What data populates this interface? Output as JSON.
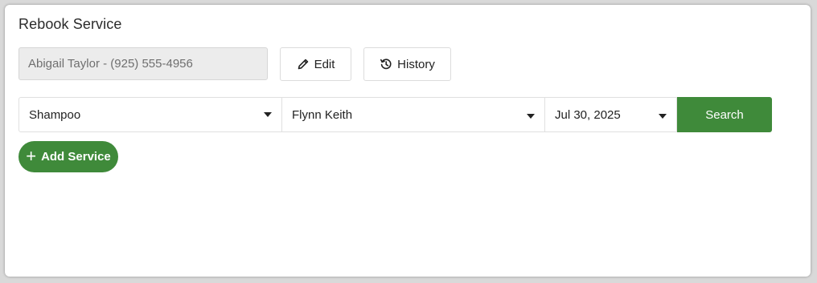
{
  "card": {
    "title": "Rebook Service"
  },
  "customer": {
    "value": "Abigail Taylor - (925) 555-4956"
  },
  "actions": {
    "edit_label": "Edit",
    "history_label": "History"
  },
  "filters": {
    "service": {
      "selected": "Shampoo"
    },
    "staff": {
      "selected": "Flynn Keith"
    },
    "date": {
      "selected": "Jul 30, 2025"
    },
    "search_label": "Search"
  },
  "add_service": {
    "icon": "+",
    "label": "Add Service"
  },
  "colors": {
    "accent_green": "#3f8a3a",
    "field_bg": "#ececec"
  },
  "icons": {
    "edit": "pencil-icon",
    "history": "history-icon",
    "caret": "caret-down-icon",
    "add": "plus-icon"
  }
}
